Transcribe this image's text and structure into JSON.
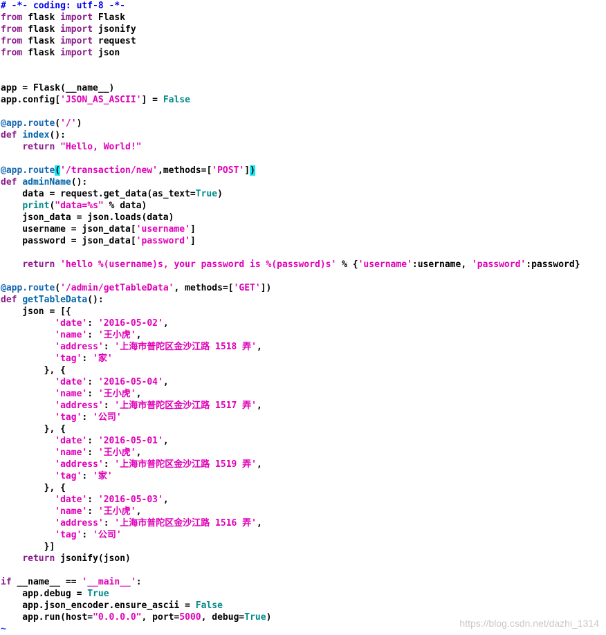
{
  "editor": {
    "lines": [
      [
        {
          "t": "# -*- coding: utf-8 -*-",
          "c": "cmt"
        }
      ],
      [
        {
          "t": "from",
          "c": "kw"
        },
        {
          "t": " flask ",
          "c": "norm"
        },
        {
          "t": "import",
          "c": "kw"
        },
        {
          "t": " Flask",
          "c": "norm"
        }
      ],
      [
        {
          "t": "from",
          "c": "kw"
        },
        {
          "t": " flask ",
          "c": "norm"
        },
        {
          "t": "import",
          "c": "kw"
        },
        {
          "t": " jsonify",
          "c": "norm"
        }
      ],
      [
        {
          "t": "from",
          "c": "kw"
        },
        {
          "t": " flask ",
          "c": "norm"
        },
        {
          "t": "import",
          "c": "kw"
        },
        {
          "t": " request",
          "c": "norm"
        }
      ],
      [
        {
          "t": "from",
          "c": "kw"
        },
        {
          "t": " flask ",
          "c": "norm"
        },
        {
          "t": "import",
          "c": "kw"
        },
        {
          "t": " json",
          "c": "norm"
        }
      ],
      [],
      [],
      [
        {
          "t": "app = Flask(__name__)",
          "c": "norm"
        }
      ],
      [
        {
          "t": "app.config[",
          "c": "norm"
        },
        {
          "t": "'JSON_AS_ASCII'",
          "c": "str"
        },
        {
          "t": "] = ",
          "c": "norm"
        },
        {
          "t": "False",
          "c": "const"
        }
      ],
      [],
      [
        {
          "t": "@app.route",
          "c": "dec"
        },
        {
          "t": "(",
          "c": "norm"
        },
        {
          "t": "'/'",
          "c": "str"
        },
        {
          "t": ")",
          "c": "norm"
        }
      ],
      [
        {
          "t": "def",
          "c": "kw"
        },
        {
          "t": " ",
          "c": "norm"
        },
        {
          "t": "index",
          "c": "fn"
        },
        {
          "t": "():",
          "c": "norm"
        }
      ],
      [
        {
          "t": "    ",
          "c": "norm"
        },
        {
          "t": "return",
          "c": "kw"
        },
        {
          "t": " ",
          "c": "norm"
        },
        {
          "t": "\"Hello, World!\"",
          "c": "str"
        }
      ],
      [],
      [
        {
          "t": "@app.route",
          "c": "dec"
        },
        {
          "t": "(",
          "c": "match"
        },
        {
          "t": "'/transaction/new'",
          "c": "str"
        },
        {
          "t": ",methods=[",
          "c": "norm"
        },
        {
          "t": "'POST'",
          "c": "str"
        },
        {
          "t": "]",
          "c": "norm"
        },
        {
          "t": ")",
          "c": "match"
        }
      ],
      [
        {
          "t": "def",
          "c": "kw"
        },
        {
          "t": " ",
          "c": "norm"
        },
        {
          "t": "adminName",
          "c": "fn"
        },
        {
          "t": "():",
          "c": "norm"
        }
      ],
      [
        {
          "t": "    data = request.get_data(as_text=",
          "c": "norm"
        },
        {
          "t": "True",
          "c": "const"
        },
        {
          "t": ")",
          "c": "norm"
        }
      ],
      [
        {
          "t": "    ",
          "c": "norm"
        },
        {
          "t": "print",
          "c": "const"
        },
        {
          "t": "(",
          "c": "norm"
        },
        {
          "t": "\"data=%s\"",
          "c": "str"
        },
        {
          "t": " % data)",
          "c": "norm"
        }
      ],
      [
        {
          "t": "    json_data = json.loads(data)",
          "c": "norm"
        }
      ],
      [
        {
          "t": "    username = json_data[",
          "c": "norm"
        },
        {
          "t": "'username'",
          "c": "str"
        },
        {
          "t": "]",
          "c": "norm"
        }
      ],
      [
        {
          "t": "    password = json_data[",
          "c": "norm"
        },
        {
          "t": "'password'",
          "c": "str"
        },
        {
          "t": "]",
          "c": "norm"
        }
      ],
      [],
      [
        {
          "t": "    ",
          "c": "norm"
        },
        {
          "t": "return",
          "c": "kw"
        },
        {
          "t": " ",
          "c": "norm"
        },
        {
          "t": "'hello %(username)s, your password is %(password)s'",
          "c": "str"
        },
        {
          "t": " % {",
          "c": "norm"
        },
        {
          "t": "'username'",
          "c": "str"
        },
        {
          "t": ":username, ",
          "c": "norm"
        },
        {
          "t": "'password'",
          "c": "str"
        },
        {
          "t": ":password}",
          "c": "norm"
        }
      ],
      [],
      [
        {
          "t": "@app.route",
          "c": "dec"
        },
        {
          "t": "(",
          "c": "norm"
        },
        {
          "t": "'/admin/getTableData'",
          "c": "str"
        },
        {
          "t": ", methods=[",
          "c": "norm"
        },
        {
          "t": "'GET'",
          "c": "str"
        },
        {
          "t": "])",
          "c": "norm"
        }
      ],
      [
        {
          "t": "def",
          "c": "kw"
        },
        {
          "t": " ",
          "c": "norm"
        },
        {
          "t": "getTableData",
          "c": "fn"
        },
        {
          "t": "():",
          "c": "norm"
        }
      ],
      [
        {
          "t": "    json = [{",
          "c": "norm"
        }
      ],
      [
        {
          "t": "          ",
          "c": "norm"
        },
        {
          "t": "'date'",
          "c": "str"
        },
        {
          "t": ": ",
          "c": "norm"
        },
        {
          "t": "'2016-05-02'",
          "c": "str"
        },
        {
          "t": ",",
          "c": "norm"
        }
      ],
      [
        {
          "t": "          ",
          "c": "norm"
        },
        {
          "t": "'name'",
          "c": "str"
        },
        {
          "t": ": ",
          "c": "norm"
        },
        {
          "t": "'王小虎'",
          "c": "str"
        },
        {
          "t": ",",
          "c": "norm"
        }
      ],
      [
        {
          "t": "          ",
          "c": "norm"
        },
        {
          "t": "'address'",
          "c": "str"
        },
        {
          "t": ": ",
          "c": "norm"
        },
        {
          "t": "'上海市普陀区金沙江路 1518 弄'",
          "c": "str"
        },
        {
          "t": ",",
          "c": "norm"
        }
      ],
      [
        {
          "t": "          ",
          "c": "norm"
        },
        {
          "t": "'tag'",
          "c": "str"
        },
        {
          "t": ": ",
          "c": "norm"
        },
        {
          "t": "'家'",
          "c": "str"
        }
      ],
      [
        {
          "t": "        }, {",
          "c": "norm"
        }
      ],
      [
        {
          "t": "          ",
          "c": "norm"
        },
        {
          "t": "'date'",
          "c": "str"
        },
        {
          "t": ": ",
          "c": "norm"
        },
        {
          "t": "'2016-05-04'",
          "c": "str"
        },
        {
          "t": ",",
          "c": "norm"
        }
      ],
      [
        {
          "t": "          ",
          "c": "norm"
        },
        {
          "t": "'name'",
          "c": "str"
        },
        {
          "t": ": ",
          "c": "norm"
        },
        {
          "t": "'王小虎'",
          "c": "str"
        },
        {
          "t": ",",
          "c": "norm"
        }
      ],
      [
        {
          "t": "          ",
          "c": "norm"
        },
        {
          "t": "'address'",
          "c": "str"
        },
        {
          "t": ": ",
          "c": "norm"
        },
        {
          "t": "'上海市普陀区金沙江路 1517 弄'",
          "c": "str"
        },
        {
          "t": ",",
          "c": "norm"
        }
      ],
      [
        {
          "t": "          ",
          "c": "norm"
        },
        {
          "t": "'tag'",
          "c": "str"
        },
        {
          "t": ": ",
          "c": "norm"
        },
        {
          "t": "'公司'",
          "c": "str"
        }
      ],
      [
        {
          "t": "        }, {",
          "c": "norm"
        }
      ],
      [
        {
          "t": "          ",
          "c": "norm"
        },
        {
          "t": "'date'",
          "c": "str"
        },
        {
          "t": ": ",
          "c": "norm"
        },
        {
          "t": "'2016-05-01'",
          "c": "str"
        },
        {
          "t": ",",
          "c": "norm"
        }
      ],
      [
        {
          "t": "          ",
          "c": "norm"
        },
        {
          "t": "'name'",
          "c": "str"
        },
        {
          "t": ": ",
          "c": "norm"
        },
        {
          "t": "'王小虎'",
          "c": "str"
        },
        {
          "t": ",",
          "c": "norm"
        }
      ],
      [
        {
          "t": "          ",
          "c": "norm"
        },
        {
          "t": "'address'",
          "c": "str"
        },
        {
          "t": ": ",
          "c": "norm"
        },
        {
          "t": "'上海市普陀区金沙江路 1519 弄'",
          "c": "str"
        },
        {
          "t": ",",
          "c": "norm"
        }
      ],
      [
        {
          "t": "          ",
          "c": "norm"
        },
        {
          "t": "'tag'",
          "c": "str"
        },
        {
          "t": ": ",
          "c": "norm"
        },
        {
          "t": "'家'",
          "c": "str"
        }
      ],
      [
        {
          "t": "        }, {",
          "c": "norm"
        }
      ],
      [
        {
          "t": "          ",
          "c": "norm"
        },
        {
          "t": "'date'",
          "c": "str"
        },
        {
          "t": ": ",
          "c": "norm"
        },
        {
          "t": "'2016-05-03'",
          "c": "str"
        },
        {
          "t": ",",
          "c": "norm"
        }
      ],
      [
        {
          "t": "          ",
          "c": "norm"
        },
        {
          "t": "'name'",
          "c": "str"
        },
        {
          "t": ": ",
          "c": "norm"
        },
        {
          "t": "'王小虎'",
          "c": "str"
        },
        {
          "t": ",",
          "c": "norm"
        }
      ],
      [
        {
          "t": "          ",
          "c": "norm"
        },
        {
          "t": "'address'",
          "c": "str"
        },
        {
          "t": ": ",
          "c": "norm"
        },
        {
          "t": "'上海市普陀区金沙江路 1516 弄'",
          "c": "str"
        },
        {
          "t": ",",
          "c": "norm"
        }
      ],
      [
        {
          "t": "          ",
          "c": "norm"
        },
        {
          "t": "'tag'",
          "c": "str"
        },
        {
          "t": ": ",
          "c": "norm"
        },
        {
          "t": "'公司'",
          "c": "str"
        }
      ],
      [
        {
          "t": "        }]",
          "c": "norm"
        }
      ],
      [
        {
          "t": "    ",
          "c": "norm"
        },
        {
          "t": "return",
          "c": "kw"
        },
        {
          "t": " jsonify(json)",
          "c": "norm"
        }
      ],
      [],
      [
        {
          "t": "if",
          "c": "kw"
        },
        {
          "t": " __name__ == ",
          "c": "norm"
        },
        {
          "t": "'__main__'",
          "c": "str"
        },
        {
          "t": ":",
          "c": "norm"
        }
      ],
      [
        {
          "t": "    app.debug = ",
          "c": "norm"
        },
        {
          "t": "True",
          "c": "const"
        }
      ],
      [
        {
          "t": "    app.json_encoder.ensure_ascii = ",
          "c": "norm"
        },
        {
          "t": "False",
          "c": "const"
        }
      ],
      [
        {
          "t": "    app.run(host=",
          "c": "norm"
        },
        {
          "t": "\"0.0.0.0\"",
          "c": "str"
        },
        {
          "t": ", port=",
          "c": "norm"
        },
        {
          "t": "5000",
          "c": "num"
        },
        {
          "t": ", debug=",
          "c": "norm"
        },
        {
          "t": "True",
          "c": "const"
        },
        {
          "t": ")",
          "c": "norm"
        }
      ],
      [
        {
          "t": "~",
          "c": "tilde"
        }
      ]
    ]
  },
  "colors": {
    "keyword": "#8b1a8b",
    "comment": "#0000ee",
    "function": "#0066aa",
    "decorator": "#1565b0",
    "constant": "#008b8b",
    "string": "#e000b8",
    "match_highlight": "#14e8f0",
    "background": "#ffffff"
  },
  "watermark": {
    "text": "https://blog.csdn.net/dazhi_1314"
  }
}
